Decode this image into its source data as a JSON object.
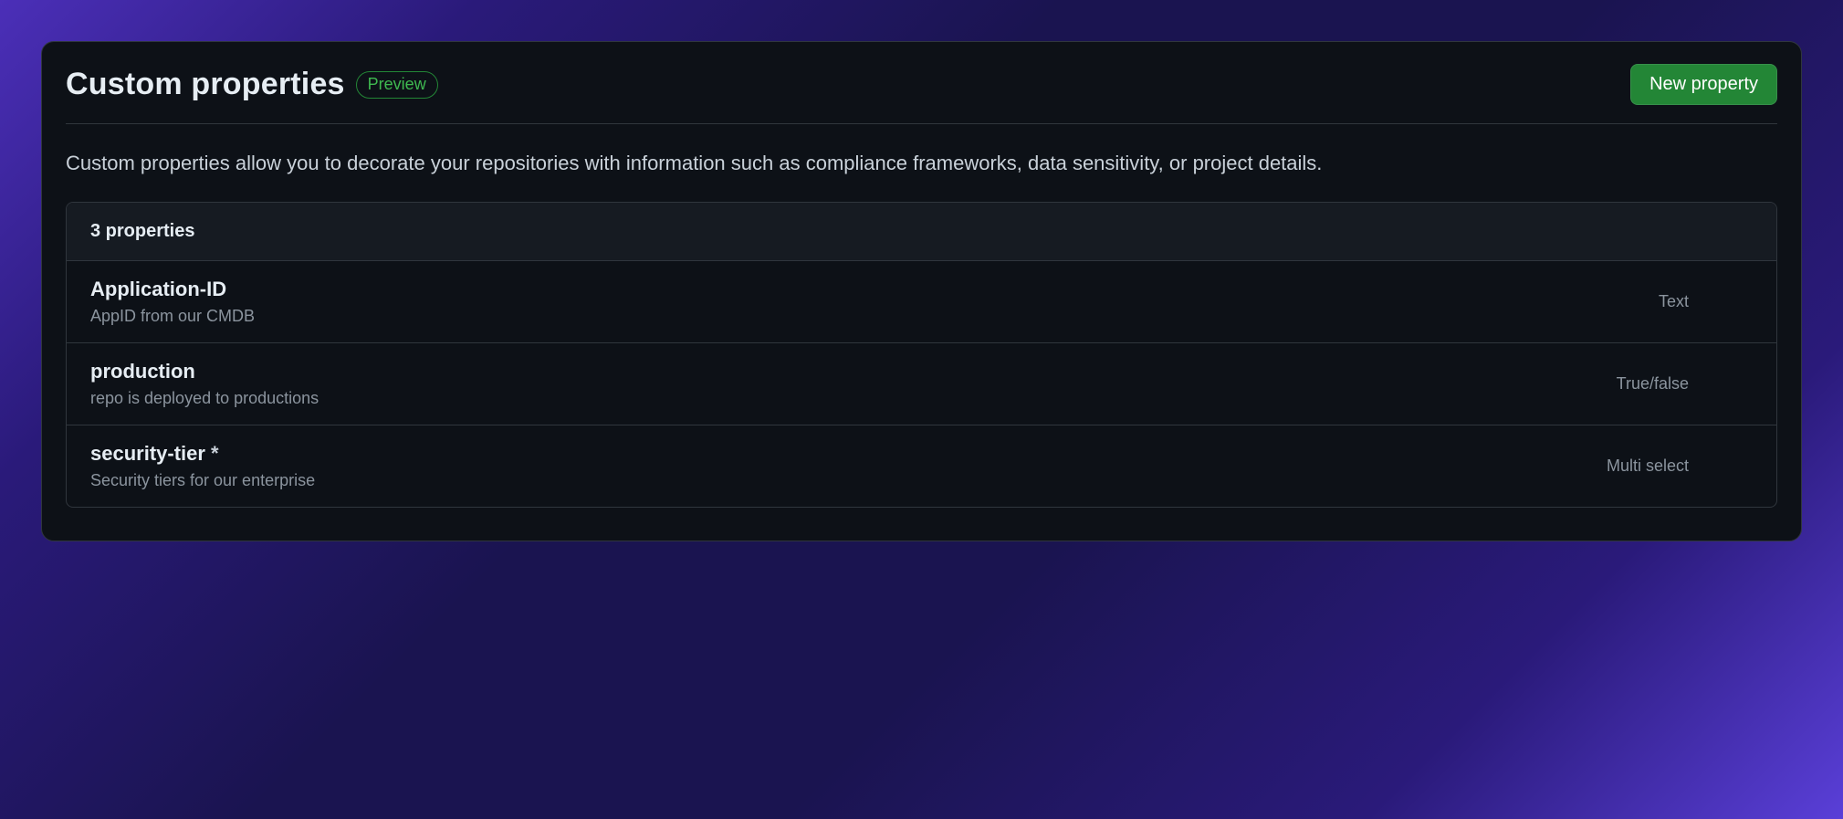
{
  "header": {
    "title": "Custom properties",
    "badge": "Preview",
    "new_button": "New property"
  },
  "description": "Custom properties allow you to decorate your repositories with information such as compliance frameworks, data sensitivity, or project details.",
  "list": {
    "count_label": "3 properties",
    "items": [
      {
        "name": "Application-ID",
        "required": false,
        "desc": "AppID from our CMDB",
        "type": "Text"
      },
      {
        "name": "production",
        "required": false,
        "desc": "repo is deployed to productions",
        "type": "True/false"
      },
      {
        "name": "security-tier",
        "required": true,
        "desc": "Security tiers for our enterprise",
        "type": "Multi select"
      }
    ]
  }
}
